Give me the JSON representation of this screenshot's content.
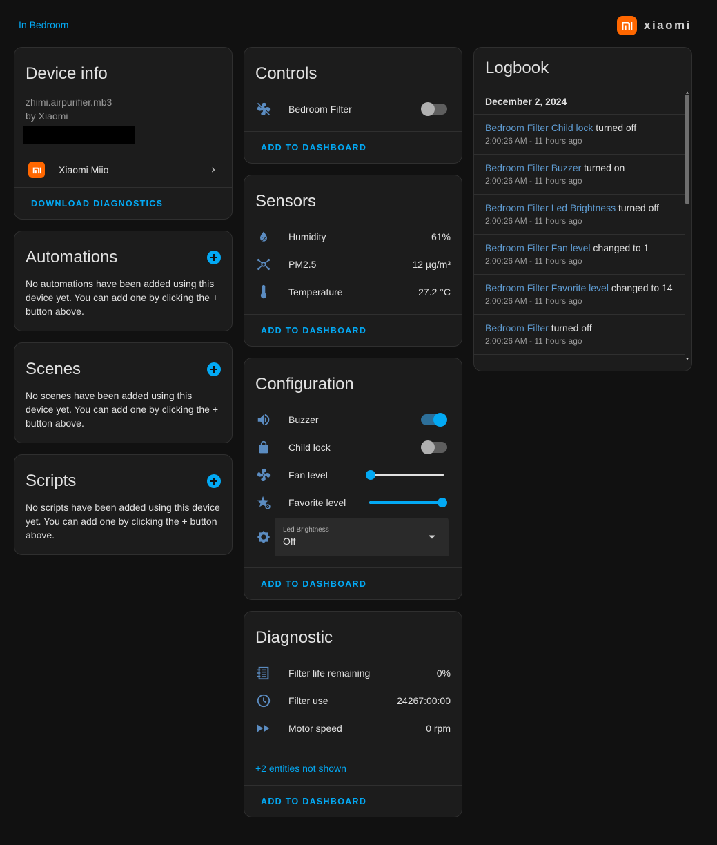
{
  "breadcrumb": {
    "area_link": "In Bedroom"
  },
  "brand": {
    "name": "xiaomi",
    "color": "#ff6700"
  },
  "accent": "#03a9f4",
  "device_info": {
    "title": "Device info",
    "model": "zhimi.airpurifier.mb3",
    "manufacturer": "by Xiaomi",
    "integration": "Xiaomi Miio",
    "download_label": "DOWNLOAD DIAGNOSTICS"
  },
  "automations": {
    "title": "Automations",
    "description": "No automations have been added using this device yet. You can add one by clicking the + button above."
  },
  "scenes": {
    "title": "Scenes",
    "description": "No scenes have been added using this device yet. You can add one by clicking the + button above."
  },
  "scripts": {
    "title": "Scripts",
    "description": "No scripts have been added using this device yet. You can add one by clicking the + button above."
  },
  "controls": {
    "title": "Controls",
    "items": [
      {
        "name": "Bedroom Filter",
        "icon": "fan-off-icon",
        "state": "off"
      }
    ],
    "add_label": "ADD TO DASHBOARD"
  },
  "sensors": {
    "title": "Sensors",
    "items": [
      {
        "name": "Humidity",
        "value": "61%",
        "icon": "water-percent-icon"
      },
      {
        "name": "PM2.5",
        "value": "12 µg/m³",
        "icon": "molecule-icon"
      },
      {
        "name": "Temperature",
        "value": "27.2 °C",
        "icon": "thermometer-icon"
      }
    ],
    "add_label": "ADD TO DASHBOARD"
  },
  "configuration": {
    "title": "Configuration",
    "buzzer": {
      "name": "Buzzer",
      "state": "on",
      "icon": "volume-icon"
    },
    "child_lock": {
      "name": "Child lock",
      "state": "off",
      "icon": "lock-icon"
    },
    "fan_level": {
      "name": "Fan level",
      "fraction": 0.0,
      "icon": "fan-icon"
    },
    "favorite_level": {
      "name": "Favorite level",
      "fraction": 1.0,
      "icon": "star-cog-icon"
    },
    "led_brightness": {
      "label": "Led Brightness",
      "value": "Off",
      "icon": "brightness-icon"
    },
    "add_label": "ADD TO DASHBOARD"
  },
  "diagnostic": {
    "title": "Diagnostic",
    "items": [
      {
        "name": "Filter life remaining",
        "value": "0%",
        "icon": "air-filter-icon"
      },
      {
        "name": "Filter use",
        "value": "24267:00:00",
        "icon": "clock-icon"
      },
      {
        "name": "Motor speed",
        "value": "0 rpm",
        "icon": "fast-forward-icon"
      }
    ],
    "more_label": "+2 entities not shown",
    "add_label": "ADD TO DASHBOARD"
  },
  "logbook": {
    "title": "Logbook",
    "date": "December 2, 2024",
    "entries": [
      {
        "entity": "Bedroom Filter Child lock",
        "action": "turned off",
        "time": "2:00:26 AM - 11 hours ago"
      },
      {
        "entity": "Bedroom Filter Buzzer",
        "action": "turned on",
        "time": "2:00:26 AM - 11 hours ago"
      },
      {
        "entity": "Bedroom Filter Led Brightness",
        "action": "turned off",
        "time": "2:00:26 AM - 11 hours ago"
      },
      {
        "entity": "Bedroom Filter Fan level",
        "action": "changed to 1",
        "time": "2:00:26 AM - 11 hours ago"
      },
      {
        "entity": "Bedroom Filter Favorite level",
        "action": "changed to 14",
        "time": "2:00:26 AM - 11 hours ago"
      },
      {
        "entity": "Bedroom Filter",
        "action": "turned off",
        "time": "2:00:26 AM - 11 hours ago"
      }
    ]
  }
}
